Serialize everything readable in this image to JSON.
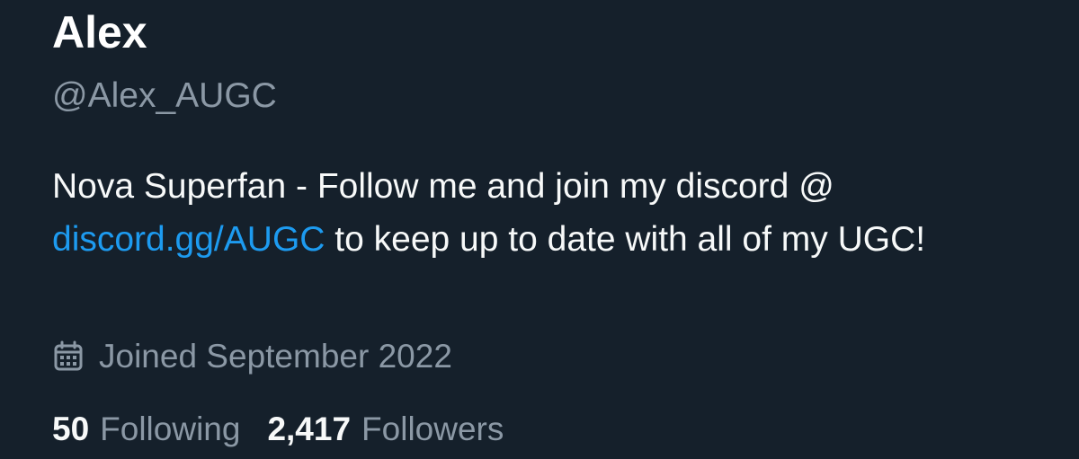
{
  "profile": {
    "display_name": "Alex",
    "handle": "@Alex_AUGC",
    "bio": {
      "text_before": "Nova Superfan - Follow me and join my discord @ ",
      "link": "discord.gg/AUGC",
      "text_after": " to keep up to date with all of my UGC!"
    },
    "joined_icon": "calendar-icon",
    "joined": "Joined September 2022",
    "following_count": "50",
    "following_label": "Following",
    "followers_count": "2,417",
    "followers_label": "Followers"
  },
  "colors": {
    "background": "#15202b",
    "primary_text": "#f7f9f9",
    "secondary_text": "#8b98a5",
    "link": "#1d9bf0"
  }
}
